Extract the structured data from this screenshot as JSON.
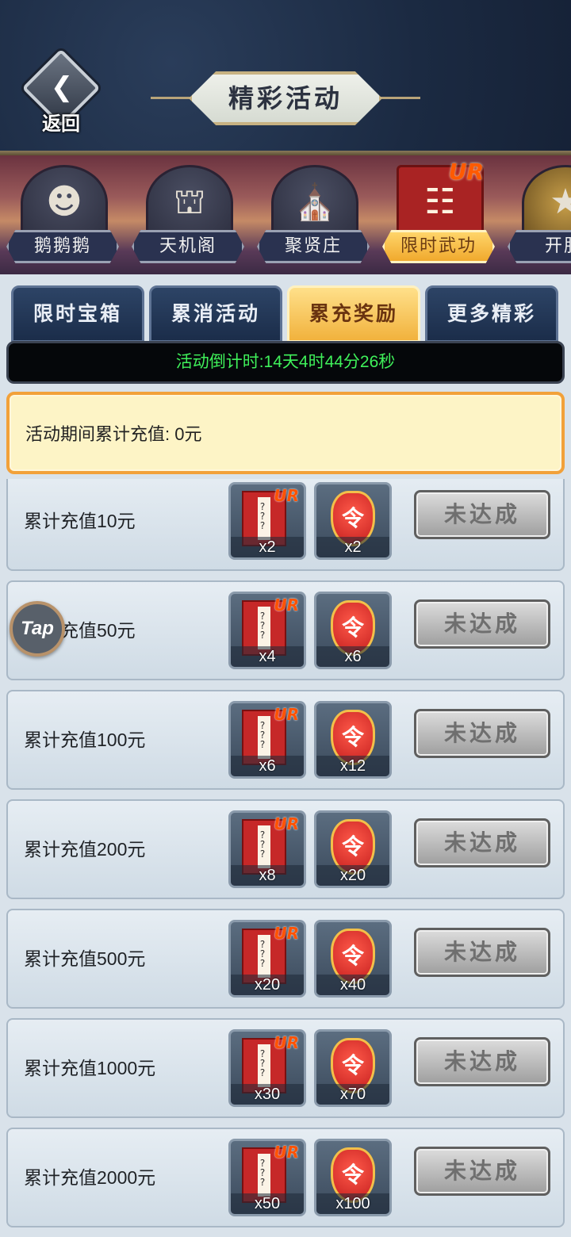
{
  "header": {
    "back_label": "返回",
    "title": "精彩活动"
  },
  "categories": [
    {
      "label": "鹅鹅鹅",
      "icon": "mask-icon",
      "active": false
    },
    {
      "label": "天机阁",
      "icon": "pavilion-icon",
      "active": false
    },
    {
      "label": "聚贤庄",
      "icon": "palace-icon",
      "active": false
    },
    {
      "label": "限时武功",
      "icon": "scroll-icon",
      "badge": "UR",
      "active": true
    },
    {
      "label": "开服",
      "icon": "trophy-icon",
      "active": false
    }
  ],
  "tabs": [
    {
      "label": "限时宝箱",
      "active": false
    },
    {
      "label": "累消活动",
      "active": false
    },
    {
      "label": "累充奖励",
      "active": true
    },
    {
      "label": "更多精彩",
      "active": false
    }
  ],
  "countdown": "活动倒计时:14天4时44分26秒",
  "summary": "活动期间累计充值: 0元",
  "rewards": [
    {
      "label": "累计充值10元",
      "scroll_count": "x2",
      "token_count": "x2",
      "button": "未达成"
    },
    {
      "label": "累计充值50元",
      "scroll_count": "x4",
      "token_count": "x6",
      "button": "未达成"
    },
    {
      "label": "累计充值100元",
      "scroll_count": "x6",
      "token_count": "x12",
      "button": "未达成"
    },
    {
      "label": "累计充值200元",
      "scroll_count": "x8",
      "token_count": "x20",
      "button": "未达成"
    },
    {
      "label": "累计充值500元",
      "scroll_count": "x20",
      "token_count": "x40",
      "button": "未达成"
    },
    {
      "label": "累计充值1000元",
      "scroll_count": "x30",
      "token_count": "x70",
      "button": "未达成"
    },
    {
      "label": "累计充值2000元",
      "scroll_count": "x50",
      "token_count": "x100",
      "button": "未达成"
    }
  ],
  "item_badge": "UR",
  "token_glyph": "令",
  "tap_overlay": "Tap",
  "colors": {
    "countdown_text": "#3ff05a",
    "active_tab": "#f1b23d",
    "summary_border": "#f2a13a",
    "ur_badge": "#ff5200"
  }
}
